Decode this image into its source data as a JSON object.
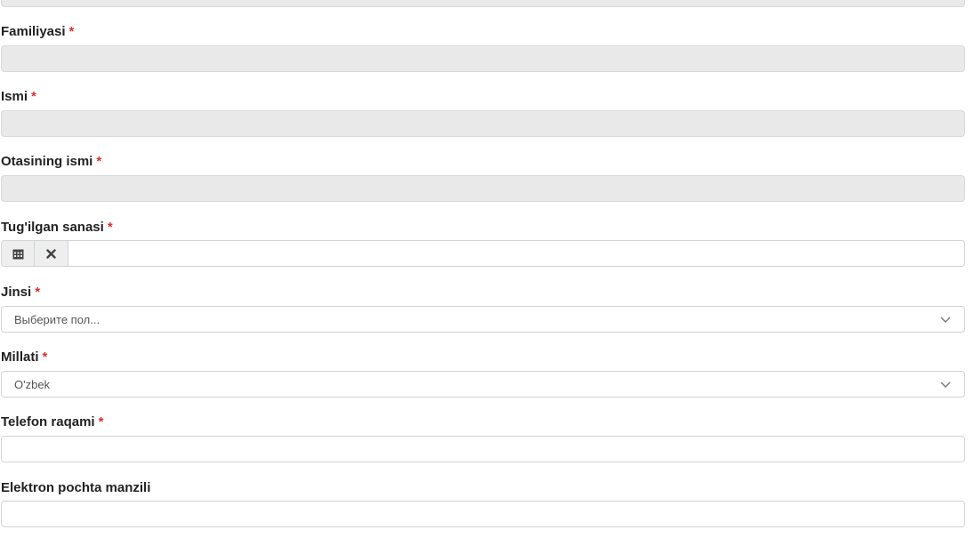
{
  "form": {
    "familiyasi": {
      "label": "Familiyasi",
      "required": "*",
      "value": ""
    },
    "ismi": {
      "label": "Ismi",
      "required": "*",
      "value": ""
    },
    "otasining_ismi": {
      "label": "Otasining ismi",
      "required": "*",
      "value": ""
    },
    "tugilgan_sanasi": {
      "label": "Tug'ilgan sanasi",
      "required": "*",
      "value": ""
    },
    "jinsi": {
      "label": "Jinsi",
      "required": "*",
      "placeholder": "Выберите пол..."
    },
    "millati": {
      "label": "Millati",
      "required": "*",
      "value": "O'zbek"
    },
    "telefon": {
      "label": "Telefon raqami",
      "required": "*",
      "value": ""
    },
    "email": {
      "label": "Elektron pochta manzili",
      "value": ""
    }
  },
  "icons": {
    "calendar": "calendar-icon",
    "clear": "close-icon",
    "chevron": "chevron-down-icon"
  },
  "colors": {
    "required_star": "#d9302c",
    "disabled_bg": "#e9e9e9",
    "border": "#cfd4d9"
  }
}
